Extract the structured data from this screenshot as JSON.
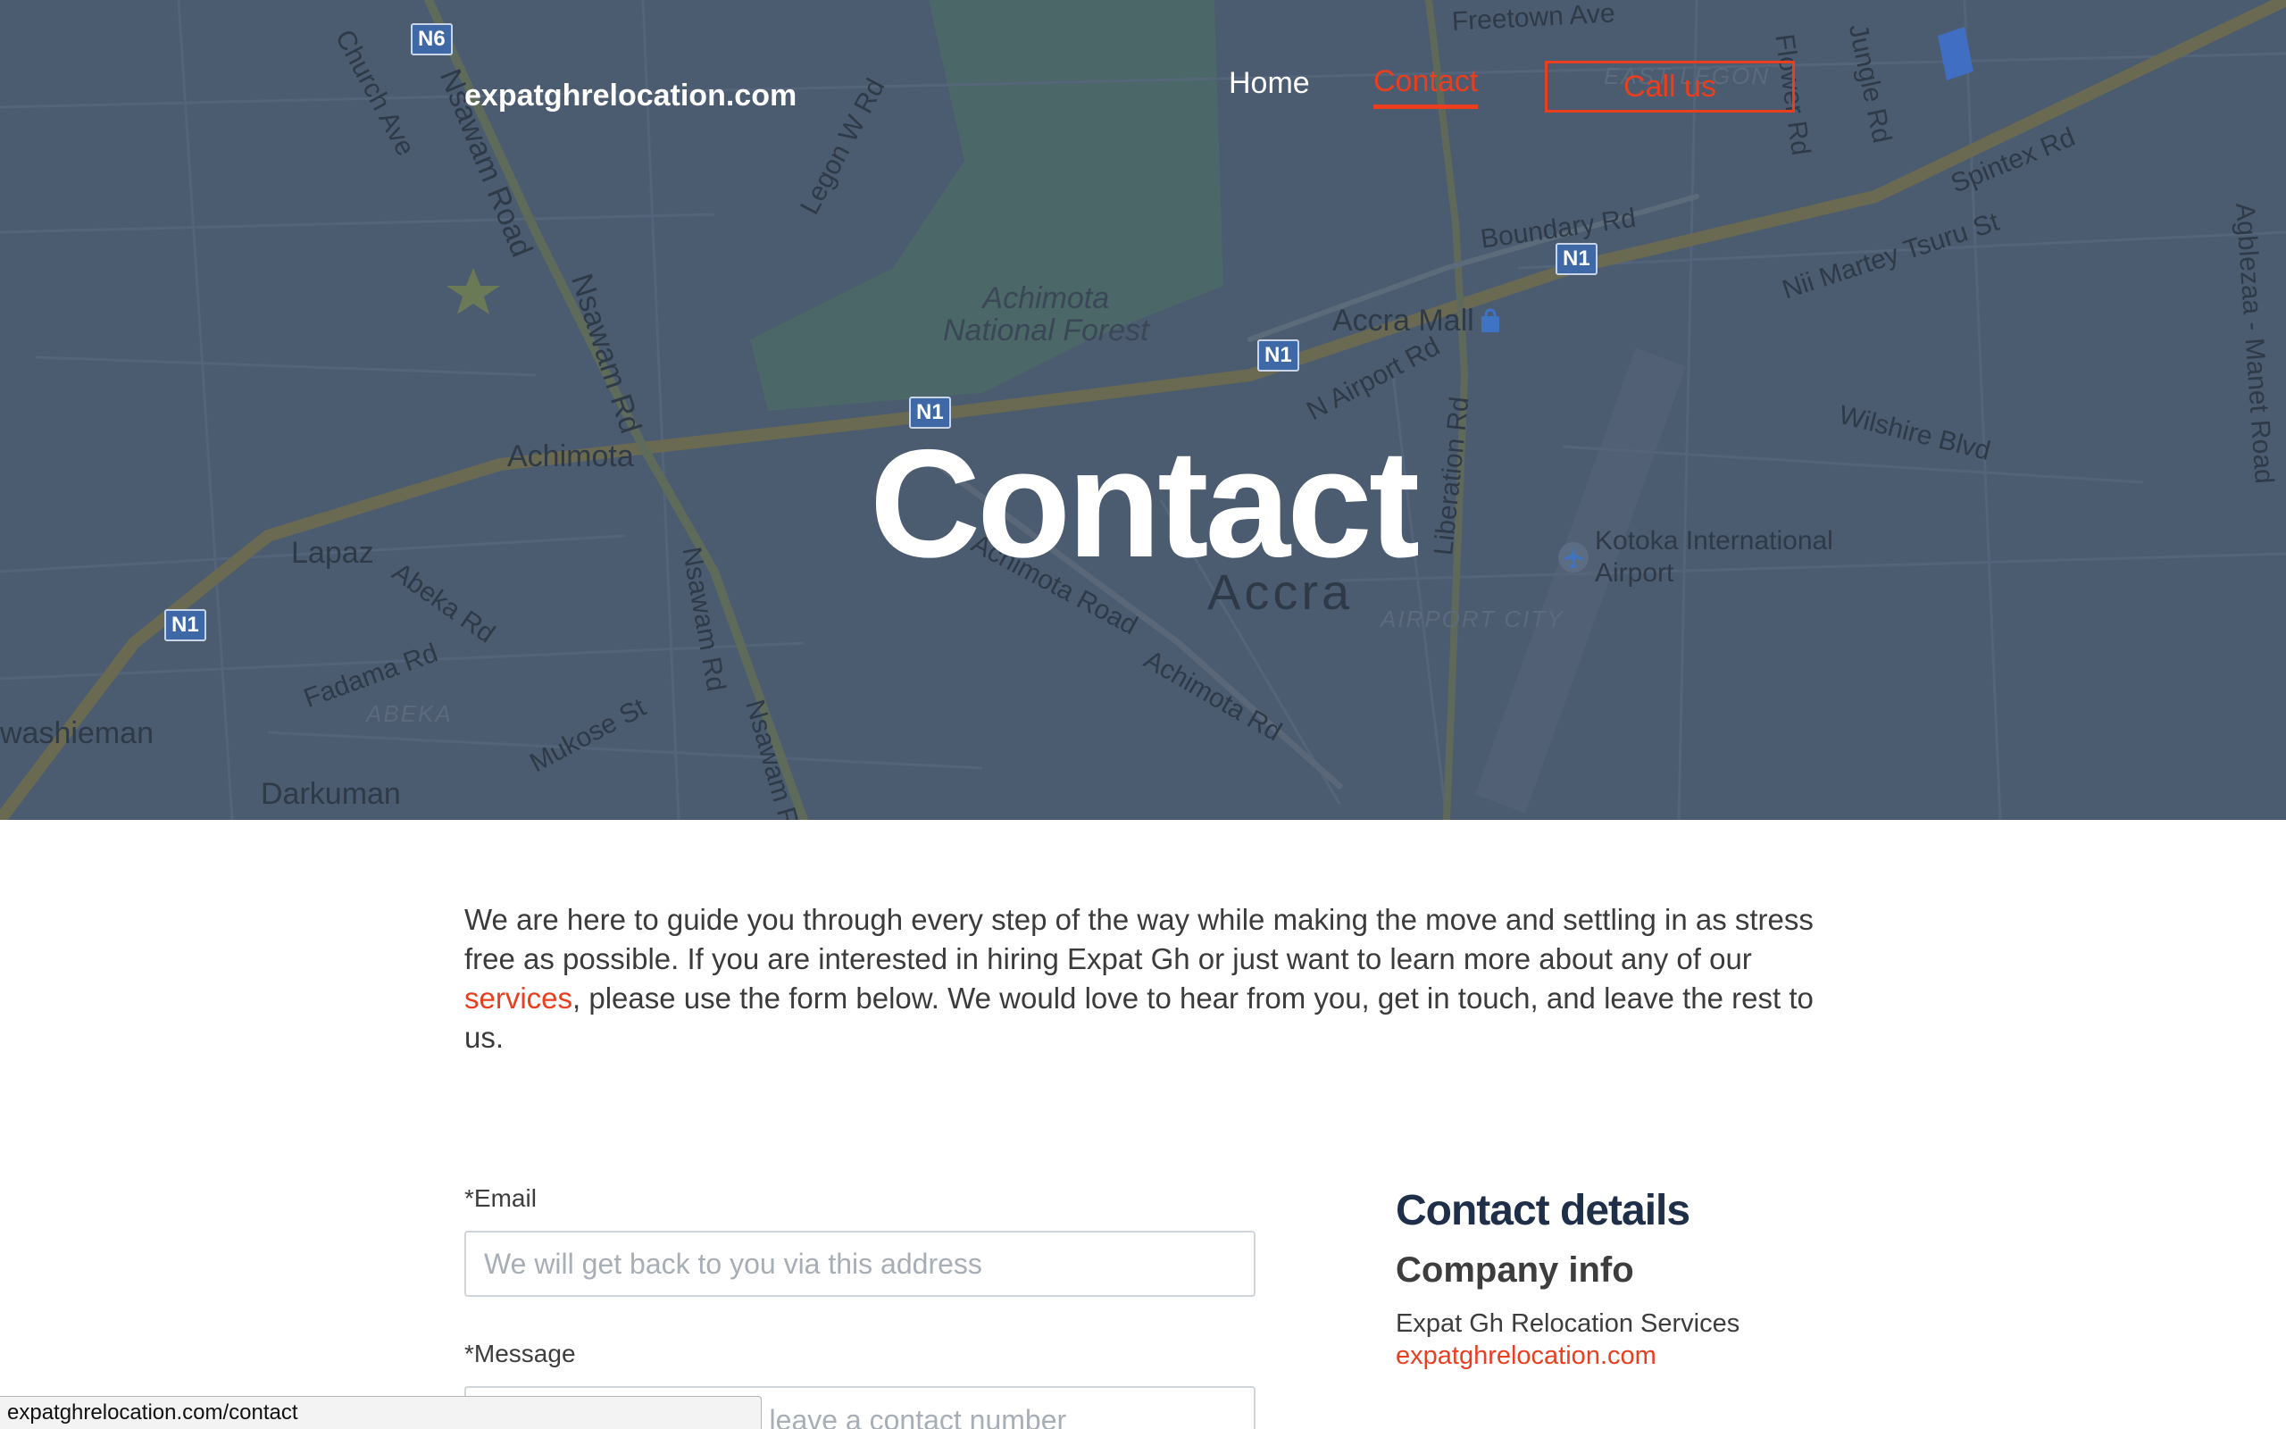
{
  "header": {
    "brand": "expatghrelocation.com",
    "nav": {
      "home": "Home",
      "contact": "Contact",
      "call": "Call us"
    }
  },
  "hero": {
    "title": "Contact"
  },
  "map": {
    "labels": {
      "freetown_ave": "Freetown Ave",
      "church_ave": "Church Ave",
      "nsawam_road": "Nsawam Road",
      "nsawam_rd_1": "Nsawam Rd",
      "nsawam_rd_2": "Nsawam Rd",
      "nsawam_rd_3": "Nsawam Rd",
      "legon_w_rd": "Legon W Rd",
      "achimota_forest": "Achimota\nNational Forest",
      "achimota": "Achimota",
      "lapaz": "Lapaz",
      "abeka_rd": "Abeka Rd",
      "fadama_rd": "Fadama Rd",
      "abeka": "ABEKA",
      "kwashieman": "washieman",
      "darkuman": "Darkuman",
      "mukose_st": "Mukose St",
      "boundary_rd": "Boundary Rd",
      "accra_mall": "Accra Mall",
      "n_airport_rd": "N Airport Rd",
      "liberation_rd": "Liberation Rd",
      "achimota_road": "Achimota Road",
      "achimota_rd": "Achimota Rd",
      "accra": "Accra",
      "airport_city": "AIRPORT CITY",
      "kotoka": "Kotoka International\nAirport",
      "east_legon": "EAST LEGON",
      "flower_rd": "Flower Rd",
      "jungle_rd": "Jungle Rd",
      "spintex_rd": "Spintex Rd",
      "nii_martey": "Nii Martey Tsuru St",
      "wilshire_blvd": "Wilshire Blvd",
      "agbleza": "Agblezaa - Manet Road",
      "road_n6": "N6",
      "road_n1": "N1"
    }
  },
  "intro": {
    "before_link": "We are here to guide you through every step of the way while making the move and settling in as stress free as possible. If you are interested in hiring Expat Gh or just want to learn more about any of our ",
    "link": "services",
    "after_link": ", please use the form below. We would love to hear from you, get in touch, and leave the rest to us."
  },
  "form": {
    "email_label": "*Email",
    "email_placeholder": "We will get back to you via this address",
    "message_label": "*Message",
    "message_placeholder": "Alternatively, you may leave a contact number"
  },
  "contact_details": {
    "heading": "Contact details",
    "subheading": "Company info",
    "company": "Expat Gh Relocation Services",
    "website": "expatghrelocation.com"
  },
  "status_bar": {
    "url": "expatghrelocation.com/contact"
  },
  "colors": {
    "accent": "#ea3e1f",
    "hero_overlay": "#4b5b70",
    "heading_navy": "#1f2f49"
  }
}
